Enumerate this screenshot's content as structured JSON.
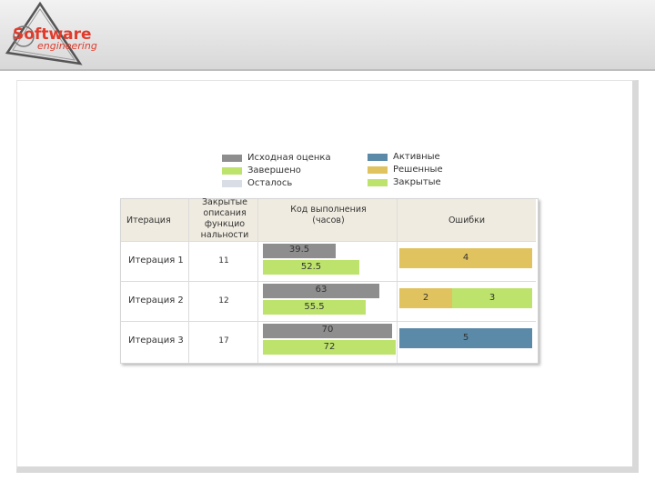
{
  "logo": {
    "main": "Software",
    "sub": "engineering"
  },
  "colors": {
    "estimate": "#8e8e8e",
    "completed": "#bde36c",
    "remaining": "#d9dee6",
    "active": "#5a8aa8",
    "resolved": "#e0c35e",
    "closed": "#bde36c",
    "header_bg": "#efebe0"
  },
  "legend_left": [
    {
      "label": "Исходная оценка",
      "color_key": "estimate"
    },
    {
      "label": "Завершено",
      "color_key": "completed"
    },
    {
      "label": "Осталось",
      "color_key": "remaining"
    }
  ],
  "legend_right": [
    {
      "label": "Активные",
      "color_key": "active"
    },
    {
      "label": "Решенные",
      "color_key": "resolved"
    },
    {
      "label": "Закрытые",
      "color_key": "closed"
    }
  ],
  "table": {
    "headers": {
      "iteration": "Итерация",
      "closed_desc": [
        "Закрытые",
        "описания",
        "функцио",
        "нальности"
      ],
      "code": [
        "Код выполнения",
        "(часов)"
      ],
      "bugs": "Ошибки"
    }
  },
  "chart_data": {
    "type": "table",
    "rows": [
      {
        "iteration": "Итерация 1",
        "closed_features": "11",
        "estimate": 39.5,
        "completed": 52.5,
        "estimate_label": "39.5",
        "completed_label": "52.5",
        "bugs": [
          {
            "type": "resolved",
            "value": 4,
            "label": "4"
          }
        ]
      },
      {
        "iteration": "Итерация 2",
        "closed_features": "12",
        "estimate": 63,
        "completed": 55.5,
        "estimate_label": "63",
        "completed_label": "55.5",
        "bugs": [
          {
            "type": "resolved",
            "value": 2,
            "label": "2"
          },
          {
            "type": "closed",
            "value": 3,
            "label": "3"
          }
        ]
      },
      {
        "iteration": "Итерация 3",
        "closed_features": "17",
        "estimate": 70,
        "completed": 72,
        "estimate_label": "70",
        "completed_label": "72",
        "bugs": [
          {
            "type": "active",
            "value": 5,
            "label": "5"
          }
        ]
      }
    ],
    "hours_max": 72,
    "bugs_max": 5
  }
}
